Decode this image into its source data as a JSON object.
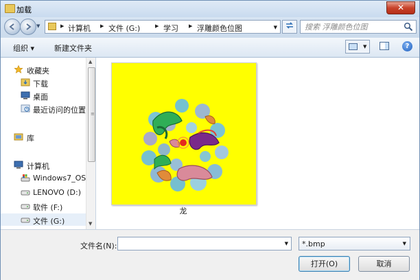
{
  "window": {
    "title": "加载",
    "close_label": "✕"
  },
  "address_bar": {
    "breadcrumbs": [
      "计算机",
      "文件 (G:)",
      "学习",
      "浮雕颜色位图"
    ]
  },
  "search": {
    "placeholder": "搜索 浮雕颜色位图"
  },
  "toolbar": {
    "organize_label": "组织 ▾",
    "new_folder_label": "新建文件夹",
    "help_label": "?"
  },
  "nav_pane": {
    "items": [
      {
        "label": "收藏夹",
        "icon": "star-icon"
      },
      {
        "label": "下载",
        "icon": "download-folder-icon"
      },
      {
        "label": "桌面",
        "icon": "desktop-icon"
      },
      {
        "label": "最近访问的位置",
        "icon": "recent-places-icon"
      },
      {
        "label": "库",
        "icon": "library-icon"
      },
      {
        "label": "计算机",
        "icon": "computer-icon"
      },
      {
        "label": "Windows7_OS (",
        "icon": "system-drive-icon"
      },
      {
        "label": "LENOVO (D:)",
        "icon": "drive-icon"
      },
      {
        "label": "软件 (F:)",
        "icon": "drive-icon"
      },
      {
        "label": "文件 (G:)",
        "icon": "drive-icon"
      }
    ],
    "selected": "文件 (G:)"
  },
  "content": {
    "files": [
      {
        "name": "龙",
        "thumbnail_bg": "#ffff00"
      }
    ]
  },
  "bottom": {
    "filename_label": "文件名(N):",
    "filename_value": "",
    "filter_value": "*.bmp",
    "open_label": "打开(O)",
    "cancel_label": "取消"
  },
  "colors": {
    "accent": "#3c7fb1",
    "thumbnail_bg": "#ffff00",
    "close_button": "#c8432b"
  }
}
